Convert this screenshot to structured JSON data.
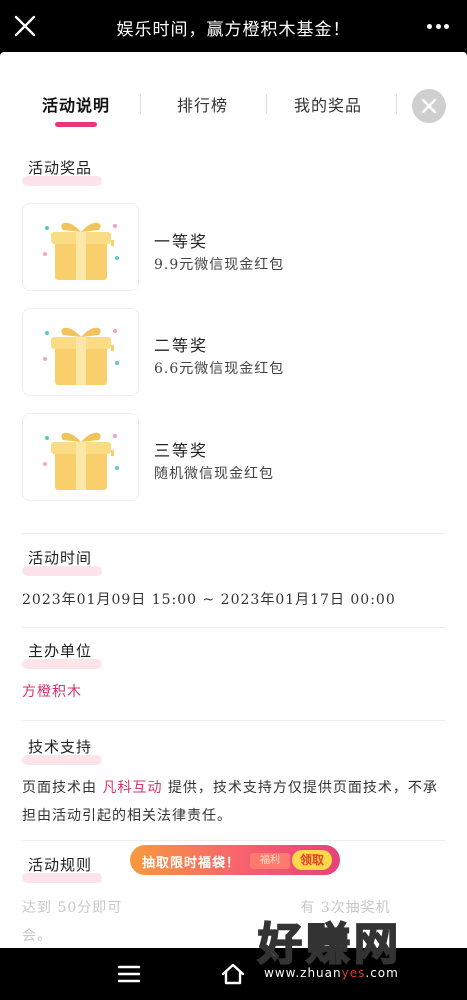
{
  "header": {
    "title": "娱乐时间，赢方橙积木基金！",
    "close_icon": "close-icon",
    "more_icon": "more-icon"
  },
  "tabs": [
    {
      "label": "活动说明",
      "active": true
    },
    {
      "label": "排行榜",
      "active": false
    },
    {
      "label": "我的奖品",
      "active": false
    }
  ],
  "prizes": {
    "section_title": "活动奖品",
    "items": [
      {
        "name": "一等奖",
        "desc": "9.9元微信现金红包",
        "icon": "gift-box-icon"
      },
      {
        "name": "二等奖",
        "desc": "6.6元微信现金红包",
        "icon": "gift-box-icon"
      },
      {
        "name": "三等奖",
        "desc": "随机微信现金红包",
        "icon": "gift-box-icon"
      }
    ]
  },
  "time": {
    "section_title": "活动时间",
    "value": "2023年01月09日 15:00 ~ 2023年01月17日 00:00"
  },
  "organizer": {
    "section_title": "主办单位",
    "value": "方橙积木"
  },
  "tech": {
    "section_title": "技术支持",
    "text_before": "页面技术由",
    "provider": "凡科互动",
    "text_after": "提供，技术支持方仅提供页面技术，不承担由活动引起的相关法律责任。"
  },
  "rules": {
    "section_title": "活动规则",
    "text_start": "达到",
    "text_score": "50分即可",
    "text_end": "有",
    "text_times": "3次抽奖机",
    "text_line2": "会。"
  },
  "banner": {
    "text": "抽取限时福袋！",
    "sub": "福利",
    "button": "领取"
  },
  "watermark": {
    "main": "好赚网",
    "url_pre": "www.zhuan",
    "url_accent": "yes",
    "url_post": ".com"
  },
  "colors": {
    "accent": "#e8387a",
    "link": "#d6336c",
    "highlight": "#fde4ea"
  }
}
